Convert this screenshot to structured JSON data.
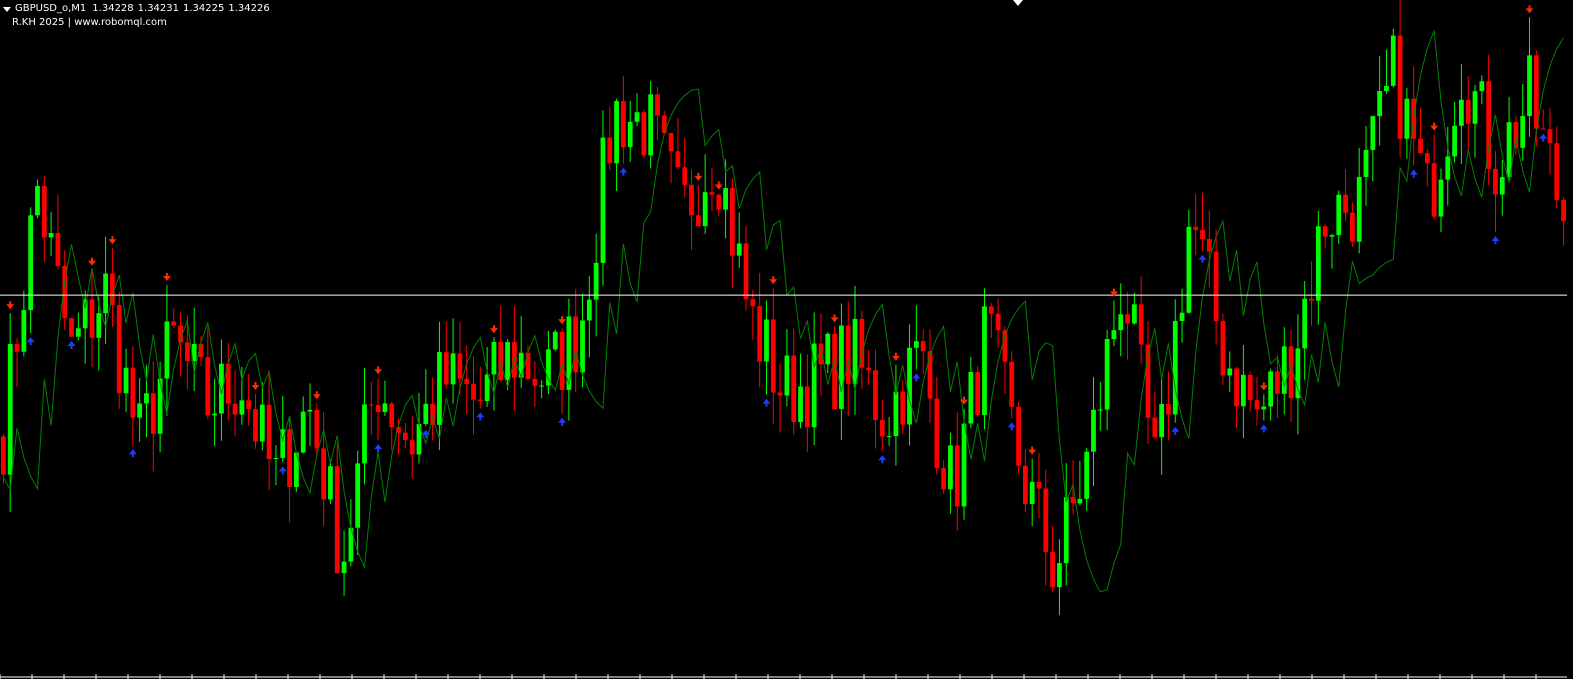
{
  "header": {
    "symbol": "GBPUSD_o,M1",
    "open": "1.34228",
    "high": "1.34231",
    "low": "1.34225",
    "close": "1.34226",
    "credit": "R.KH 2025 | www.robomql.com"
  },
  "colors": {
    "background": "#000000",
    "bull": "#00ff00",
    "bear": "#ff0000",
    "trail_line": "#008000",
    "price_line": "#ffffff",
    "buy_arrow": "#1e3cff",
    "sell_arrow": "#ff2a00",
    "axis": "#ffffff"
  },
  "icons": {
    "symbol_menu": "triangle-down-icon",
    "chart_shift": "shift-marker-icon",
    "buy_signal": "arrow-up-icon",
    "sell_signal": "arrow-down-icon"
  },
  "chart_data": {
    "type": "candlestick",
    "bar_count": 230,
    "current_price": 1.34226,
    "y_range": [
      1.3393,
      1.3445
    ],
    "swing_closes": [
      1.3412,
      1.3431,
      1.3418,
      1.3423,
      1.3411,
      1.3419,
      1.3414,
      1.3416,
      1.3408,
      1.3414,
      1.3402,
      1.3416,
      1.3411,
      1.3416,
      1.3414,
      1.3418,
      1.3416,
      1.342,
      1.3437,
      1.3436,
      1.3429,
      1.3434,
      1.3421,
      1.3415,
      1.3416,
      1.3418,
      1.3413,
      1.3418,
      1.3407,
      1.342,
      1.3409,
      1.3401,
      1.341,
      1.3424,
      1.3408,
      1.3429,
      1.3418,
      1.3413,
      1.3418,
      1.3429,
      1.343,
      1.344,
      1.343,
      1.3441,
      1.3433,
      1.3438,
      1.3429
    ],
    "buy_signal_bars": [
      4,
      10,
      19,
      41,
      55,
      62,
      70,
      82,
      91,
      112,
      129,
      134,
      148,
      172,
      176,
      185,
      207,
      219,
      226
    ],
    "sell_signal_bars": [
      1,
      13,
      16,
      24,
      37,
      46,
      55,
      72,
      82,
      102,
      105,
      113,
      122,
      131,
      141,
      151,
      163,
      185,
      210,
      224
    ]
  }
}
